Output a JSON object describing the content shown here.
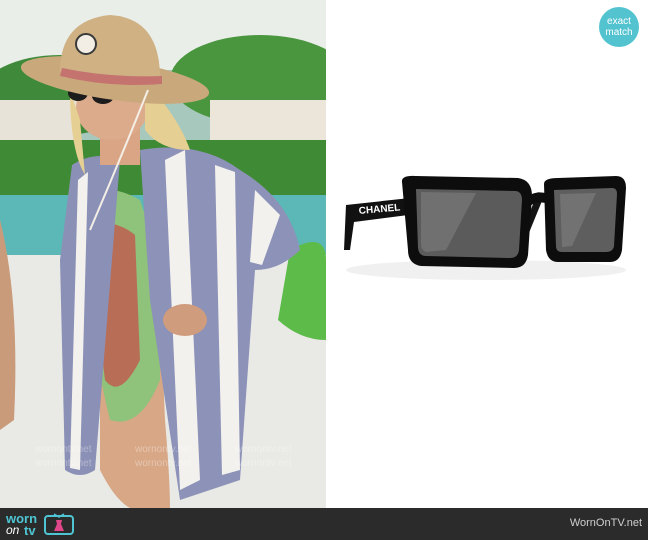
{
  "badge": {
    "line1": "exact",
    "line2": "match"
  },
  "product": {
    "brand_text": "CHANEL"
  },
  "footer": {
    "logo_worn": "worn",
    "logo_on": "on",
    "logo_tv": "tv",
    "site": "WornOnTV.net"
  },
  "watermark": {
    "text": "wornontv.net"
  },
  "colors": {
    "badge": "#52c3cf",
    "footer": "#2b2b2b",
    "logo": "#4fc5d4"
  }
}
